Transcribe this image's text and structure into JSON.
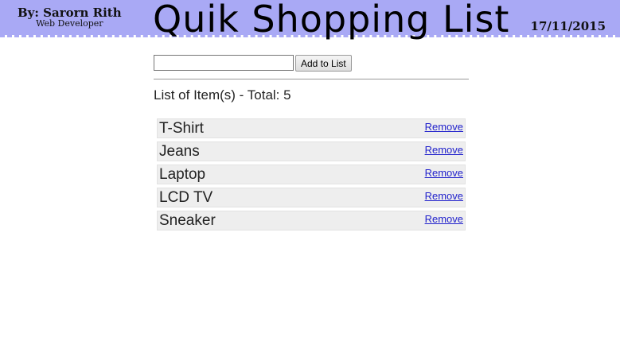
{
  "header": {
    "author_name": "By: Sarorn Rith",
    "author_role": "Web Developer",
    "title": "Quik Shopping List",
    "date": "17/11/2015"
  },
  "form": {
    "input_value": "",
    "add_button_label": "Add to List"
  },
  "list": {
    "heading": "List of Item(s) - Total: 5",
    "remove_label": "Remove",
    "items": [
      {
        "name": "T-Shirt"
      },
      {
        "name": "Jeans"
      },
      {
        "name": "Laptop"
      },
      {
        "name": "LCD TV"
      },
      {
        "name": "Sneaker"
      }
    ]
  },
  "colors": {
    "header_bg": "#a9a9f5",
    "link": "#2222cc",
    "item_bg": "#eeeeee"
  }
}
